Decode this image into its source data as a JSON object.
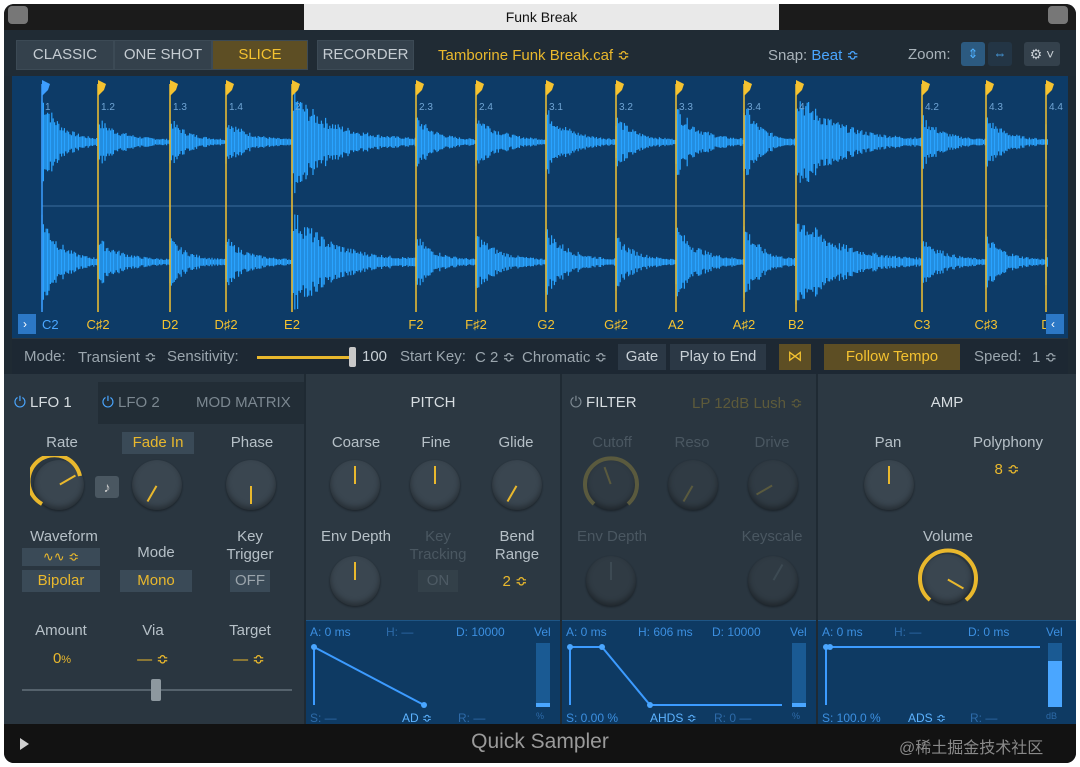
{
  "window": {
    "title": "Funk Break"
  },
  "toolbar": {
    "modes": [
      {
        "label": "CLASSIC",
        "active": false
      },
      {
        "label": "ONE SHOT",
        "active": false
      },
      {
        "label": "SLICE",
        "active": true
      }
    ],
    "recorder_label": "RECORDER",
    "file": "Tamborine Funk Break.caf ≎",
    "snap_label": "Snap:",
    "snap_value": "Beat ≎",
    "zoom_label": "Zoom:",
    "settings_icon": "gear-icon"
  },
  "waveform": {
    "beat_labels": [
      "1",
      "1.2",
      "1.3",
      "1.4",
      "2",
      "2.3",
      "2.4",
      "3.1",
      "3.2",
      "3.3",
      "3.4",
      "4",
      "4.2",
      "4.3",
      "4.4"
    ],
    "slice_keys": [
      "C2",
      "C♯2",
      "D2",
      "D♯2",
      "E2",
      "F2",
      "F♯2",
      "G2",
      "G♯2",
      "A2",
      "A♯2",
      "B2",
      "C3",
      "C♯3",
      "D"
    ],
    "wave_color": "#29a3ff",
    "marker_color": "#f4c230"
  },
  "slice_bar": {
    "mode_label": "Mode:",
    "mode_value": "Transient ≎",
    "sensitivity_label": "Sensitivity:",
    "sensitivity_value": "100",
    "start_key_label": "Start Key:",
    "start_key_value": "C 2 ≎",
    "scale_value": "Chromatic ≎",
    "gate_label": "Gate",
    "play_to_end_label": "Play to End",
    "follow_tempo_label": "Follow Tempo",
    "speed_label": "Speed:",
    "speed_value": "1 ≎"
  },
  "lfo": {
    "tab1": "LFO 1",
    "tab2": "LFO 2",
    "tab3": "MOD MATRIX",
    "rate_label": "Rate",
    "fade_in_label": "Fade In",
    "phase_label": "Phase",
    "waveform_label": "Waveform",
    "mode_label": "Mode",
    "key_trigger_label": "Key\nTrigger",
    "bipolar_value": "Bipolar",
    "mono_value": "Mono",
    "off_value": "OFF",
    "amount_label": "Amount",
    "via_label": "Via",
    "target_label": "Target",
    "amount_value": "0",
    "amount_unit": "%",
    "via_value": "— ≎",
    "target_value": "— ≎"
  },
  "pitch": {
    "title": "PITCH",
    "coarse_label": "Coarse",
    "fine_label": "Fine",
    "glide_label": "Glide",
    "env_depth_label": "Env Depth",
    "key_tracking_label": "Key\nTracking",
    "bend_range_label": "Bend\nRange",
    "key_tracking_value": "ON",
    "bend_range_value": "2 ≎",
    "env": {
      "a": "A: 0 ms",
      "h": "H: —",
      "d": "D: 10000",
      "vel": "Vel",
      "s": "S: —",
      "mode": "AD ≎",
      "r": "R: —",
      "pct": "%"
    }
  },
  "filter": {
    "title": "FILTER",
    "type_value": "LP 12dB Lush ≎",
    "cutoff_label": "Cutoff",
    "reso_label": "Reso",
    "drive_label": "Drive",
    "env_depth_label": "Env Depth",
    "keyscale_label": "Keyscale",
    "env": {
      "a": "A: 0 ms",
      "h": "H: 606 ms",
      "d": "D: 10000",
      "vel": "Vel",
      "s": "S: 0.00 %",
      "mode": "AHDS ≎",
      "r": "R: 0 —",
      "pct": "%"
    }
  },
  "amp": {
    "title": "AMP",
    "pan_label": "Pan",
    "polyphony_label": "Polyphony",
    "polyphony_value": "8 ≎",
    "volume_label": "Volume",
    "env": {
      "a": "A: 0 ms",
      "h": "H: —",
      "d": "D: 0 ms",
      "vel": "Vel",
      "s": "S: 100.0 %",
      "mode": "ADS ≎",
      "r": "R: —",
      "db": "dB"
    }
  },
  "footer": {
    "title": "Quick Sampler",
    "watermark": "@稀土掘金技术社区"
  }
}
